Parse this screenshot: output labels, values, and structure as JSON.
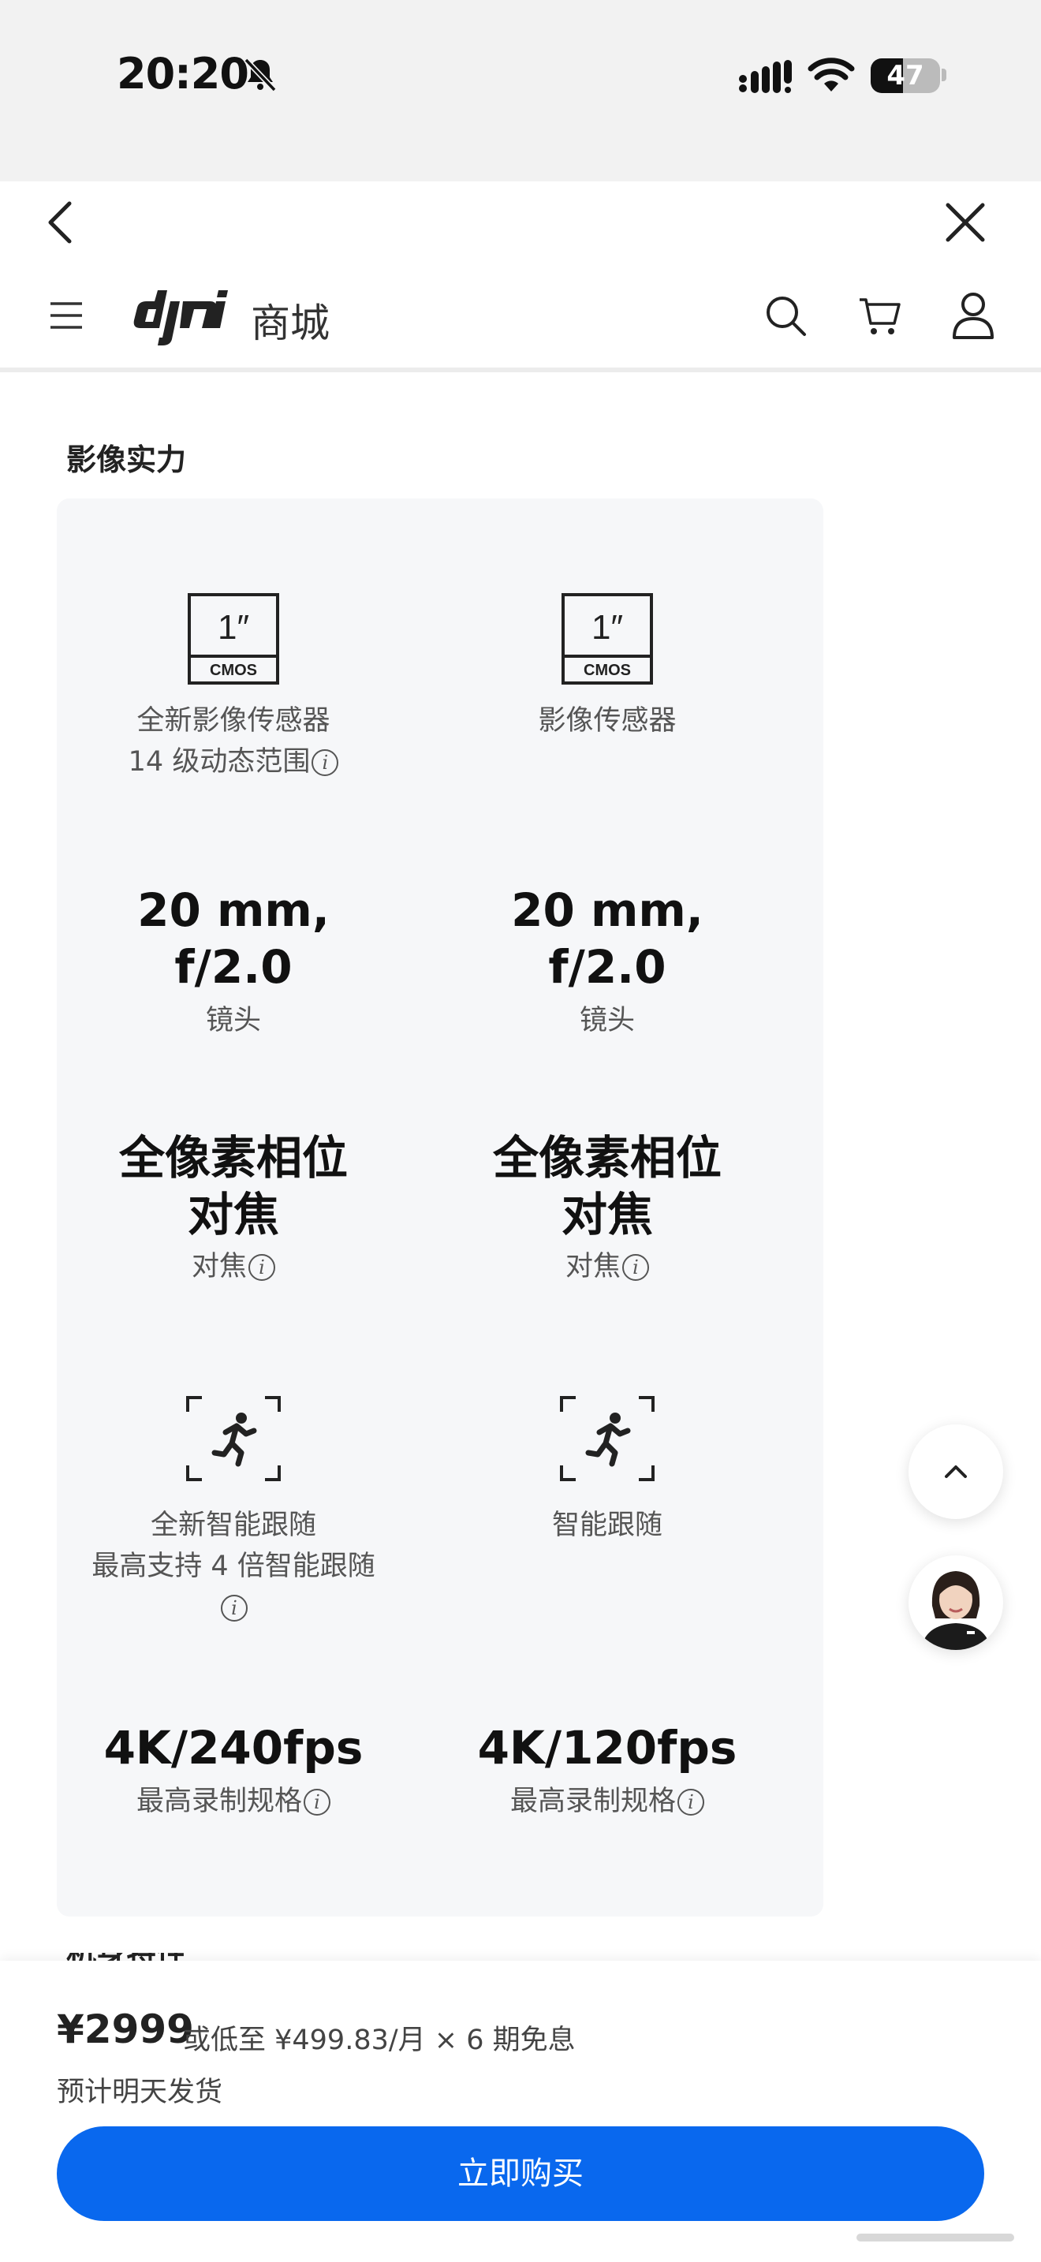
{
  "status_bar": {
    "time": "20:20",
    "battery_level": "47"
  },
  "header": {
    "store_title": "商城"
  },
  "section": {
    "title": "影像实力",
    "next_title": "机身特性"
  },
  "specs": [
    {
      "left": {
        "icon_label": "1″",
        "icon_sub": "CMOS",
        "line1": "全新影像传感器",
        "line2": "14 级动态范围"
      },
      "right": {
        "icon_label": "1″",
        "icon_sub": "CMOS",
        "line1": "影像传感器",
        "line2": ""
      }
    },
    {
      "left": {
        "big1": "20 mm,",
        "big2": "f/2.0",
        "sub": "镜头"
      },
      "right": {
        "big1": "20 mm,",
        "big2": "f/2.0",
        "sub": "镜头"
      }
    },
    {
      "left": {
        "big1": "全像素相位",
        "big2": "对焦",
        "sub": "对焦"
      },
      "right": {
        "big1": "全像素相位",
        "big2": "对焦",
        "sub": "对焦"
      }
    },
    {
      "left": {
        "line1": "全新智能跟随",
        "line2": "最高支持 4 倍智能跟随"
      },
      "right": {
        "line1": "智能跟随"
      }
    },
    {
      "left": {
        "big1": "4K/240fps",
        "sub": "最高录制规格"
      },
      "right": {
        "big1": "4K/120fps",
        "sub": "最高录制规格"
      }
    }
  ],
  "info_glyph": "i",
  "purchase": {
    "price": "¥2999",
    "installment": "或低至 ¥499.83/月 × 6 期免息",
    "shipping": "预计明天发货",
    "buy_label": "立即购买"
  },
  "colors": {
    "accent": "#0968ee",
    "card_bg": "#f6f7f9"
  },
  "icons": [
    "bell-off-icon",
    "signal-icon",
    "wifi-icon",
    "battery-icon",
    "back-icon",
    "close-icon",
    "menu-icon",
    "dji-logo",
    "search-icon",
    "cart-icon",
    "user-icon",
    "cmos-sensor-icon",
    "subject-tracking-icon",
    "info-icon",
    "chevron-up-icon",
    "support-avatar"
  ]
}
